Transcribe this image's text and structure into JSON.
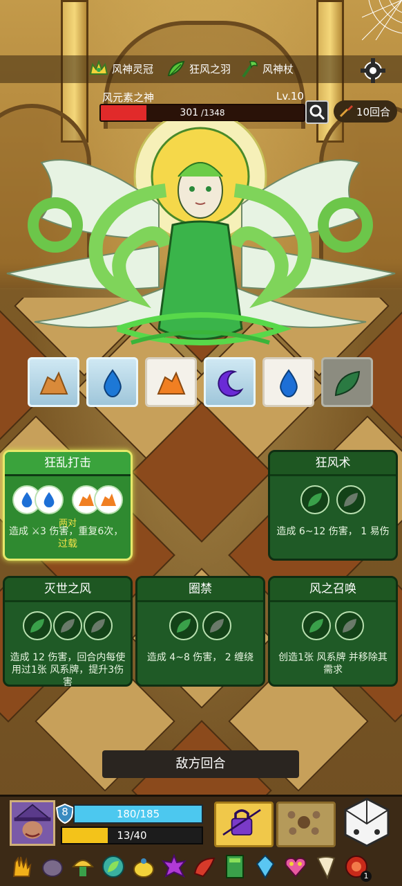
{
  "relics": [
    {
      "icon": "wind-crown-icon",
      "label": "风神灵冠"
    },
    {
      "icon": "wind-feather-icon",
      "label": "狂风之羽"
    },
    {
      "icon": "wind-staff-icon",
      "label": "风神杖"
    }
  ],
  "boss": {
    "name": "风元素之神",
    "level": "Lv.10",
    "hp_current": "301",
    "hp_max": " /1348",
    "hp_fraction": 0.223
  },
  "round_counter": "10回合",
  "intents": [
    {
      "icon": "rock-icon",
      "state": "frozen"
    },
    {
      "icon": "water-drop-icon",
      "state": "frozen"
    },
    {
      "icon": "rock-icon",
      "state": "normal"
    },
    {
      "icon": "moon-icon",
      "state": "frozen"
    },
    {
      "icon": "water-drop-icon",
      "state": "normal"
    },
    {
      "icon": "wind-leaf-icon",
      "state": "dim"
    }
  ],
  "skills": [
    {
      "title": "狂乱打击",
      "pair_label": "两对",
      "desc": "造成 ⚔3 伤害，重复6次，",
      "overload": "过载"
    },
    {
      "title": "狂风术",
      "desc": "造成 6~12 伤害， 1 易伤"
    },
    {
      "title": "灭世之风",
      "desc": "造成 12 伤害，回合内每使用过1张 风系牌，提升3伤害"
    },
    {
      "title": "圈禁",
      "desc": "造成 4~8 伤害， 2 缠绕"
    },
    {
      "title": "风之召唤",
      "desc": "创造1张 风系牌 并移除其需求"
    }
  ],
  "enemy_turn_label": "敌方回合",
  "player": {
    "shield": "8",
    "hp_text": "180/185",
    "energy_text": "13/40",
    "energy_fraction": 0.325
  },
  "inventory_badge": "1",
  "colors": {
    "hp_red": "#e12a2a",
    "hp_blue": "#4cc8ef",
    "energy_yellow": "#f3c31a",
    "card_green": "#1f5a26"
  }
}
